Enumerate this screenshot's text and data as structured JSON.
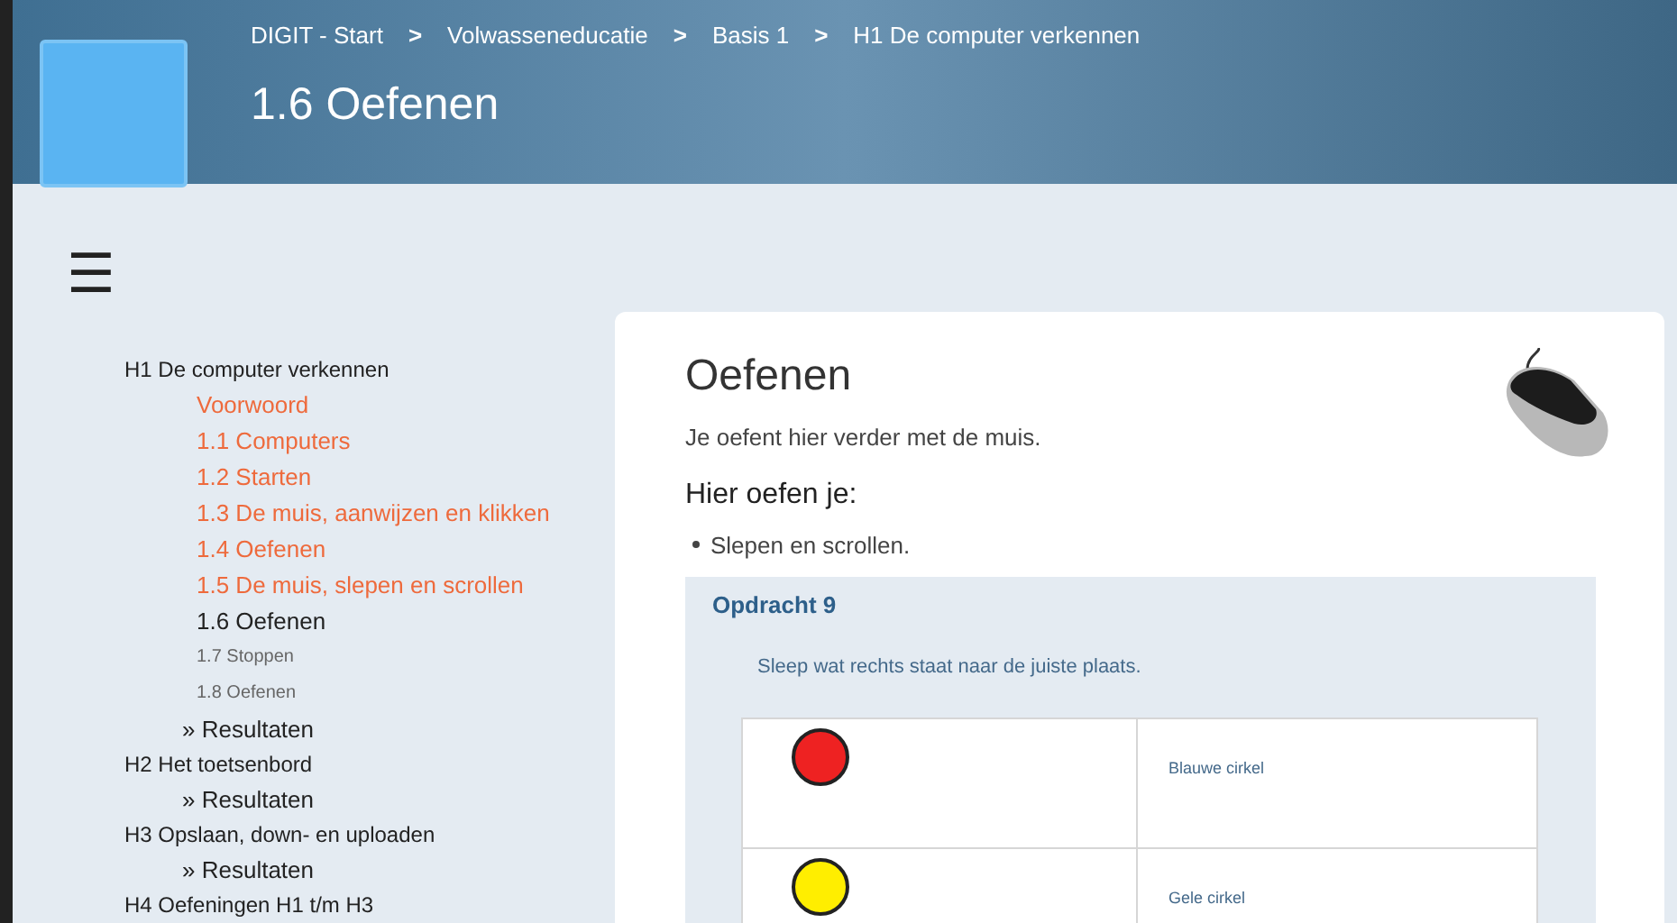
{
  "header": {
    "breadcrumbs": [
      "DIGIT - Start",
      "Volwasseneducatie",
      "Basis 1",
      "H1 De computer verkennen"
    ],
    "separator": ">",
    "title": "1.6 Oefenen"
  },
  "menu_icon": "☰",
  "sidebar": {
    "chapters": [
      {
        "title": "H1 De computer verkennen",
        "children": [
          {
            "label": "Voorwoord",
            "kind": "done"
          },
          {
            "label": "1.1 Computers",
            "kind": "done"
          },
          {
            "label": "1.2 Starten",
            "kind": "done"
          },
          {
            "label": "1.3 De muis, aanwijzen en klikken",
            "kind": "done"
          },
          {
            "label": "1.4 Oefenen",
            "kind": "done"
          },
          {
            "label": "1.5 De muis, slepen en scrollen",
            "kind": "done"
          },
          {
            "label": "1.6 Oefenen",
            "kind": "current"
          },
          {
            "label": "1.7 Stoppen",
            "kind": "todo"
          },
          {
            "label": "1.8 Oefenen",
            "kind": "todo"
          },
          {
            "label": "» Resultaten",
            "kind": "results"
          }
        ]
      },
      {
        "title": "H2 Het toetsenbord",
        "children": [
          {
            "label": "» Resultaten",
            "kind": "results"
          }
        ]
      },
      {
        "title": "H3 Opslaan, down- en uploaden",
        "children": [
          {
            "label": "» Resultaten",
            "kind": "results"
          }
        ]
      },
      {
        "title": "H4 Oefeningen H1 t/m H3"
      }
    ]
  },
  "content": {
    "title": "Oefenen",
    "intro": "Je oefent hier verder met de muis.",
    "subtitle": "Hier oefen je:",
    "bullets": [
      "Slepen en scrollen."
    ],
    "exercise": {
      "title": "Opdracht 9",
      "instruction": "Sleep wat rechts staat naar de juiste plaats.",
      "rows": [
        {
          "color": "#ee2222",
          "label": "Blauwe cirkel"
        },
        {
          "color": "#ffee00",
          "label": "Gele cirkel"
        }
      ]
    }
  }
}
